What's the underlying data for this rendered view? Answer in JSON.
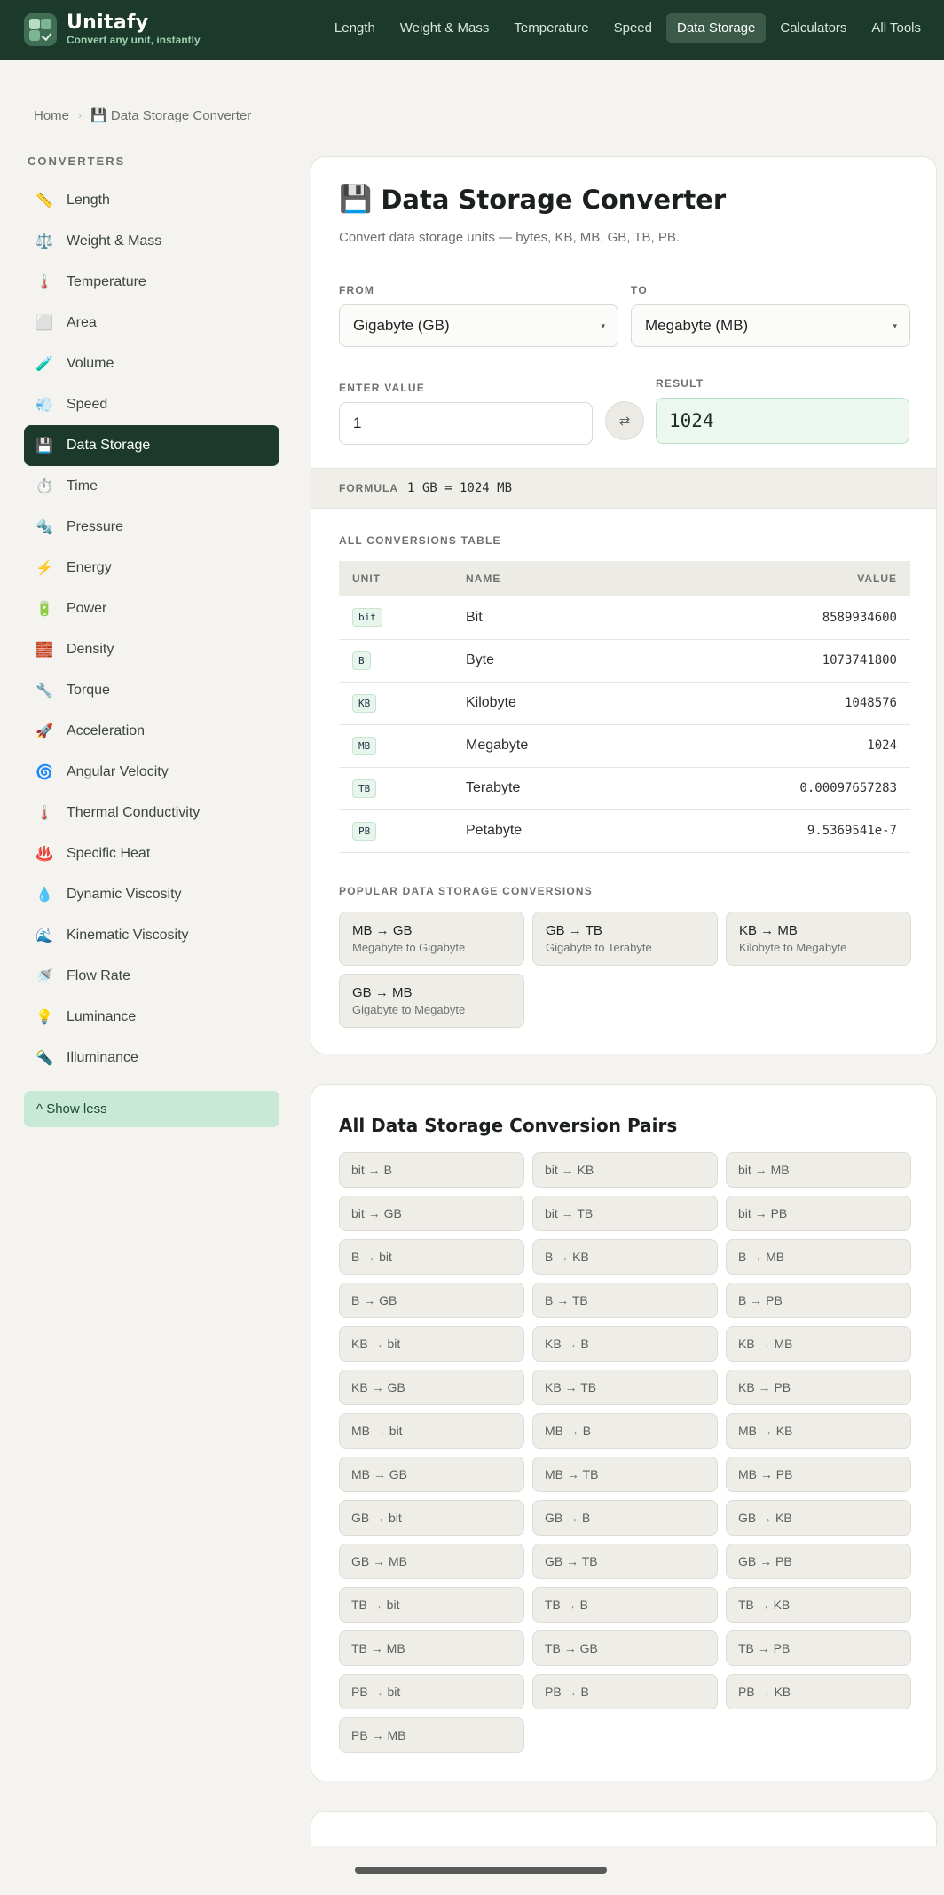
{
  "brand": {
    "name": "Unitafy",
    "tagline": "Convert any unit, instantly"
  },
  "nav": [
    {
      "label": "Length"
    },
    {
      "label": "Weight & Mass"
    },
    {
      "label": "Temperature"
    },
    {
      "label": "Speed"
    },
    {
      "label": "Data Storage",
      "active": true
    },
    {
      "label": "Calculators"
    },
    {
      "label": "All Tools"
    }
  ],
  "breadcrumb": {
    "home": "Home",
    "current": "💾 Data Storage Converter"
  },
  "sidebar": {
    "heading": "CONVERTERS",
    "items": [
      {
        "icon": "📏",
        "label": "Length"
      },
      {
        "icon": "⚖️",
        "label": "Weight & Mass"
      },
      {
        "icon": "🌡️",
        "label": "Temperature"
      },
      {
        "icon": "⬜",
        "label": "Area"
      },
      {
        "icon": "🧪",
        "label": "Volume"
      },
      {
        "icon": "💨",
        "label": "Speed"
      },
      {
        "icon": "💾",
        "label": "Data Storage",
        "active": true
      },
      {
        "icon": "⏱️",
        "label": "Time"
      },
      {
        "icon": "🔩",
        "label": "Pressure"
      },
      {
        "icon": "⚡",
        "label": "Energy"
      },
      {
        "icon": "🔋",
        "label": "Power"
      },
      {
        "icon": "🧱",
        "label": "Density"
      },
      {
        "icon": "🔧",
        "label": "Torque"
      },
      {
        "icon": "🚀",
        "label": "Acceleration"
      },
      {
        "icon": "🌀",
        "label": "Angular Velocity"
      },
      {
        "icon": "🌡️",
        "label": "Thermal Conductivity"
      },
      {
        "icon": "♨️",
        "label": "Specific Heat"
      },
      {
        "icon": "💧",
        "label": "Dynamic Viscosity"
      },
      {
        "icon": "🌊",
        "label": "Kinematic Viscosity"
      },
      {
        "icon": "🚿",
        "label": "Flow Rate"
      },
      {
        "icon": "💡",
        "label": "Luminance"
      },
      {
        "icon": "🔦",
        "label": "Illuminance"
      }
    ],
    "show_less": "^ Show less"
  },
  "converter": {
    "icon": "💾",
    "title": "Data Storage Converter",
    "subtitle": "Convert data storage units — bytes, KB, MB, GB, TB, PB.",
    "from_label": "FROM",
    "from_value": "Gigabyte (GB)",
    "to_label": "TO",
    "to_value": "Megabyte (MB)",
    "caret": "▾",
    "value_label": "ENTER VALUE",
    "value": "1",
    "swap_icon": "⇄",
    "result_label": "RESULT",
    "result": "1024",
    "formula_label": "FORMULA",
    "formula": "1 GB = 1024 MB"
  },
  "table": {
    "heading": "ALL CONVERSIONS TABLE",
    "headers": [
      "UNIT",
      "NAME",
      "VALUE"
    ],
    "rows": [
      {
        "unit": "bit",
        "name": "Bit",
        "value": "8589934600"
      },
      {
        "unit": "B",
        "name": "Byte",
        "value": "1073741800"
      },
      {
        "unit": "KB",
        "name": "Kilobyte",
        "value": "1048576"
      },
      {
        "unit": "MB",
        "name": "Megabyte",
        "value": "1024"
      },
      {
        "unit": "TB",
        "name": "Terabyte",
        "value": "0.00097657283"
      },
      {
        "unit": "PB",
        "name": "Petabyte",
        "value": "9.5369541e-7"
      }
    ]
  },
  "popular": {
    "heading": "POPULAR DATA STORAGE CONVERSIONS",
    "items": [
      {
        "title": "MB → GB",
        "desc": "Megabyte to Gigabyte"
      },
      {
        "title": "GB → TB",
        "desc": "Gigabyte to Terabyte"
      },
      {
        "title": "KB → MB",
        "desc": "Kilobyte to Megabyte"
      },
      {
        "title": "GB → MB",
        "desc": "Gigabyte to Megabyte"
      }
    ]
  },
  "pairs": {
    "heading": "All Data Storage Conversion Pairs",
    "items": [
      "bit → B",
      "bit → KB",
      "bit → MB",
      "bit → GB",
      "bit → TB",
      "bit → PB",
      "B → bit",
      "B → KB",
      "B → MB",
      "B → GB",
      "B → TB",
      "B → PB",
      "KB → bit",
      "KB → B",
      "KB → MB",
      "KB → GB",
      "KB → TB",
      "KB → PB",
      "MB → bit",
      "MB → B",
      "MB → KB",
      "MB → GB",
      "MB → TB",
      "MB → PB",
      "GB → bit",
      "GB → B",
      "GB → KB",
      "GB → MB",
      "GB → TB",
      "GB → PB",
      "TB → bit",
      "TB → B",
      "TB → KB",
      "TB → MB",
      "TB → GB",
      "TB → PB",
      "PB → bit",
      "PB → B",
      "PB → KB",
      "PB → MB"
    ]
  }
}
